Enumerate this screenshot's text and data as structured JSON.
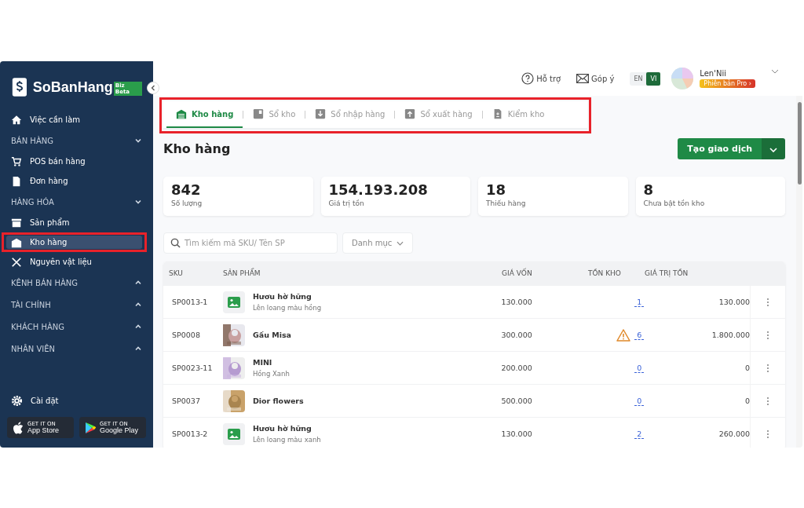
{
  "sidebar": {
    "logo": "SoBanHang",
    "logo_badge": "Biz Beta",
    "items": [
      {
        "kind": "link",
        "label": "Việc cần làm",
        "selected": false,
        "highlighted": false
      },
      {
        "kind": "section",
        "label": "BÁN HÀNG",
        "expanded": true
      },
      {
        "kind": "link",
        "label": "POS bán hàng",
        "selected": false,
        "highlighted": false
      },
      {
        "kind": "link",
        "label": "Đơn hàng",
        "selected": false,
        "highlighted": false
      },
      {
        "kind": "section",
        "label": "HÀNG HÓA",
        "expanded": true
      },
      {
        "kind": "link",
        "label": "Sản phẩm",
        "selected": false,
        "highlighted": false
      },
      {
        "kind": "link",
        "label": "Kho hàng",
        "selected": true,
        "highlighted": true
      },
      {
        "kind": "link",
        "label": "Nguyên vật liệu",
        "selected": false,
        "highlighted": false
      },
      {
        "kind": "section",
        "label": "KÊNH BÁN HÀNG",
        "expanded": false
      },
      {
        "kind": "section",
        "label": "TÀI CHÍNH",
        "expanded": false
      },
      {
        "kind": "section",
        "label": "KHÁCH HÀNG",
        "expanded": false
      },
      {
        "kind": "section",
        "label": "NHÂN VIÊN",
        "expanded": false
      }
    ],
    "settings": "Cài đặt",
    "stores": [
      {
        "small": "GET IT ON",
        "name": "App Store"
      },
      {
        "small": "GET IT ON",
        "name": "Google Play"
      }
    ]
  },
  "header": {
    "help": "Hỗ trợ",
    "feedback": "Góp ý",
    "languages": [
      {
        "label": "EN",
        "selected": false
      },
      {
        "label": "VI",
        "selected": true
      }
    ],
    "user": "Len'Nii",
    "plan": "Phiên bản Pro ›"
  },
  "tabs": {
    "highlighted": true,
    "items": [
      {
        "label": "Kho hàng",
        "selected": true
      },
      {
        "label": "Sổ kho",
        "selected": false
      },
      {
        "label": "Sổ nhập hàng",
        "selected": false
      },
      {
        "label": "Sổ xuất hàng",
        "selected": false
      },
      {
        "label": "Kiểm kho",
        "selected": false
      }
    ]
  },
  "title": "Kho hàng",
  "create_button": "Tạo giao dịch",
  "stats": [
    {
      "value": "842",
      "label": "Số lượng"
    },
    {
      "value": "154.193.208",
      "label": "Giá trị tồn"
    },
    {
      "value": "18",
      "label": "Thiếu hàng"
    },
    {
      "value": "8",
      "label": "Chưa bật tồn kho"
    }
  ],
  "search": {
    "placeholder": "Tìm kiếm mã SKU/ Tên SP"
  },
  "category_filter": "Danh mục",
  "table": {
    "columns": [
      "SKU",
      "SẢN PHẨM",
      "GIÁ VỐN",
      "TỒN KHO",
      "GIÁ TRỊ TỒN"
    ],
    "rows": [
      {
        "kind": "no_image",
        "sku": "SP0013-1",
        "name": "Hươu hờ hững",
        "variant": "Lên loang màu hồng",
        "cost": "130.000",
        "stock": "1",
        "warning": false,
        "value": "130.000"
      },
      {
        "sku": "SP0008",
        "name": "Gấu Misa",
        "cost": "300.000",
        "stock": "6",
        "warning": true,
        "value": "1.800.000"
      },
      {
        "sku": "SP0023-11",
        "name": "MINI",
        "variant": "Hồng Xanh",
        "cost": "200.000",
        "stock": "0",
        "warning": false,
        "value": "0"
      },
      {
        "sku": "SP0037",
        "name": "Dior flowers",
        "cost": "500.000",
        "stock": "0",
        "warning": false,
        "value": "0"
      },
      {
        "kind": "no_image",
        "sku": "SP0013-2",
        "name": "Hươu hờ hững",
        "variant": "Lên loang màu xanh",
        "cost": "130.000",
        "stock": "2",
        "warning": false,
        "value": "260.000"
      }
    ]
  }
}
